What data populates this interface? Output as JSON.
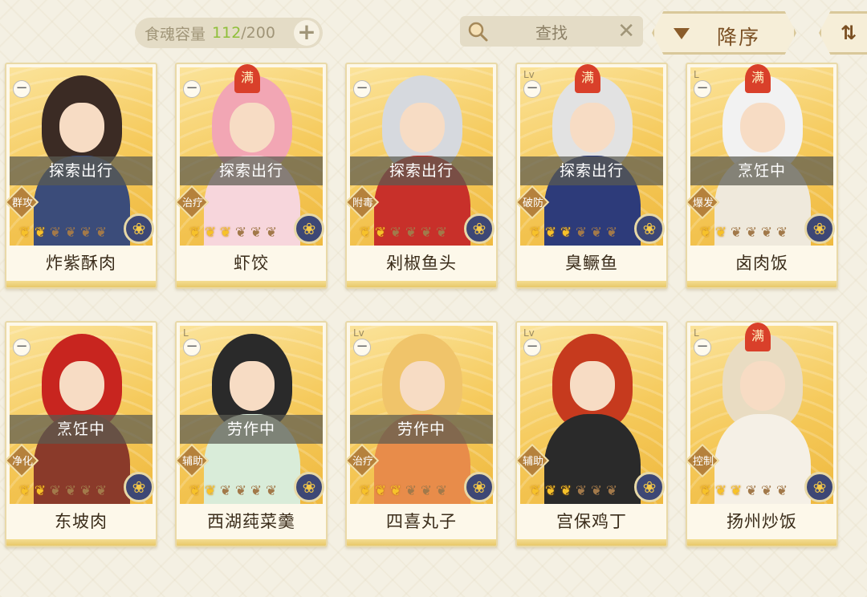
{
  "header": {
    "capacity_label": "食魂容量",
    "capacity_current": "112",
    "capacity_total": "/200",
    "plus_icon": "+",
    "search_placeholder": "查找",
    "search_clear_icon": "✕",
    "sort_label": "降序",
    "filter_icon": "⇅"
  },
  "cards": [
    {
      "name": "炸紫酥肉",
      "status": "探索出行",
      "role": "群攻",
      "stars_on": 2,
      "lv": "",
      "max": false,
      "hair": "#3b2b24",
      "robe": "#3b4c7a"
    },
    {
      "name": "虾饺",
      "status": "探索出行",
      "role": "治疗",
      "stars_on": 3,
      "lv": "",
      "max": true,
      "hair": "#f2a6b4",
      "robe": "#f7d6dc"
    },
    {
      "name": "剁椒鱼头",
      "status": "探索出行",
      "role": "附毒",
      "stars_on": 2,
      "lv": "",
      "max": false,
      "hair": "#d6d9de",
      "robe": "#c8302a"
    },
    {
      "name": "臭鳜鱼",
      "status": "探索出行",
      "role": "破防",
      "stars_on": 3,
      "lv": "Lv",
      "max": true,
      "hair": "#e2e2e2",
      "robe": "#2d3b7a"
    },
    {
      "name": "卤肉饭",
      "status": "烹饪中",
      "role": "爆发",
      "stars_on": 2,
      "lv": "L",
      "max": true,
      "hair": "#f2f2f2",
      "robe": "#efe9dc"
    },
    {
      "name": "东坡肉",
      "status": "烹饪中",
      "role": "净化",
      "stars_on": 2,
      "lv": "",
      "max": false,
      "hair": "#c8251f",
      "robe": "#8a3a2a"
    },
    {
      "name": "西湖莼菜羹",
      "status": "劳作中",
      "role": "辅助",
      "stars_on": 2,
      "lv": "L",
      "max": false,
      "hair": "#2a2a2a",
      "robe": "#d9ecd9"
    },
    {
      "name": "四喜丸子",
      "status": "劳作中",
      "role": "治疗",
      "stars_on": 3,
      "lv": "Lv",
      "max": false,
      "hair": "#f0c46a",
      "robe": "#e88c4a"
    },
    {
      "name": "宫保鸡丁",
      "status": "",
      "role": "辅助",
      "stars_on": 3,
      "lv": "Lv",
      "max": false,
      "hair": "#c63a1e",
      "robe": "#2a2a2a"
    },
    {
      "name": "扬州炒饭",
      "status": "",
      "role": "控制",
      "stars_on": 3,
      "lv": "L",
      "max": true,
      "hair": "#e9dcc2",
      "robe": "#f5f0e6"
    }
  ],
  "max_badge": "满",
  "minus_icon": "−",
  "flame_icon": "❦",
  "element_icon": "❀",
  "colors": {
    "accent_green": "#8fbf3a",
    "card_gold": "#f5c95a",
    "status_overlay": "#5a5a50",
    "element_bg": "#3d4775"
  }
}
